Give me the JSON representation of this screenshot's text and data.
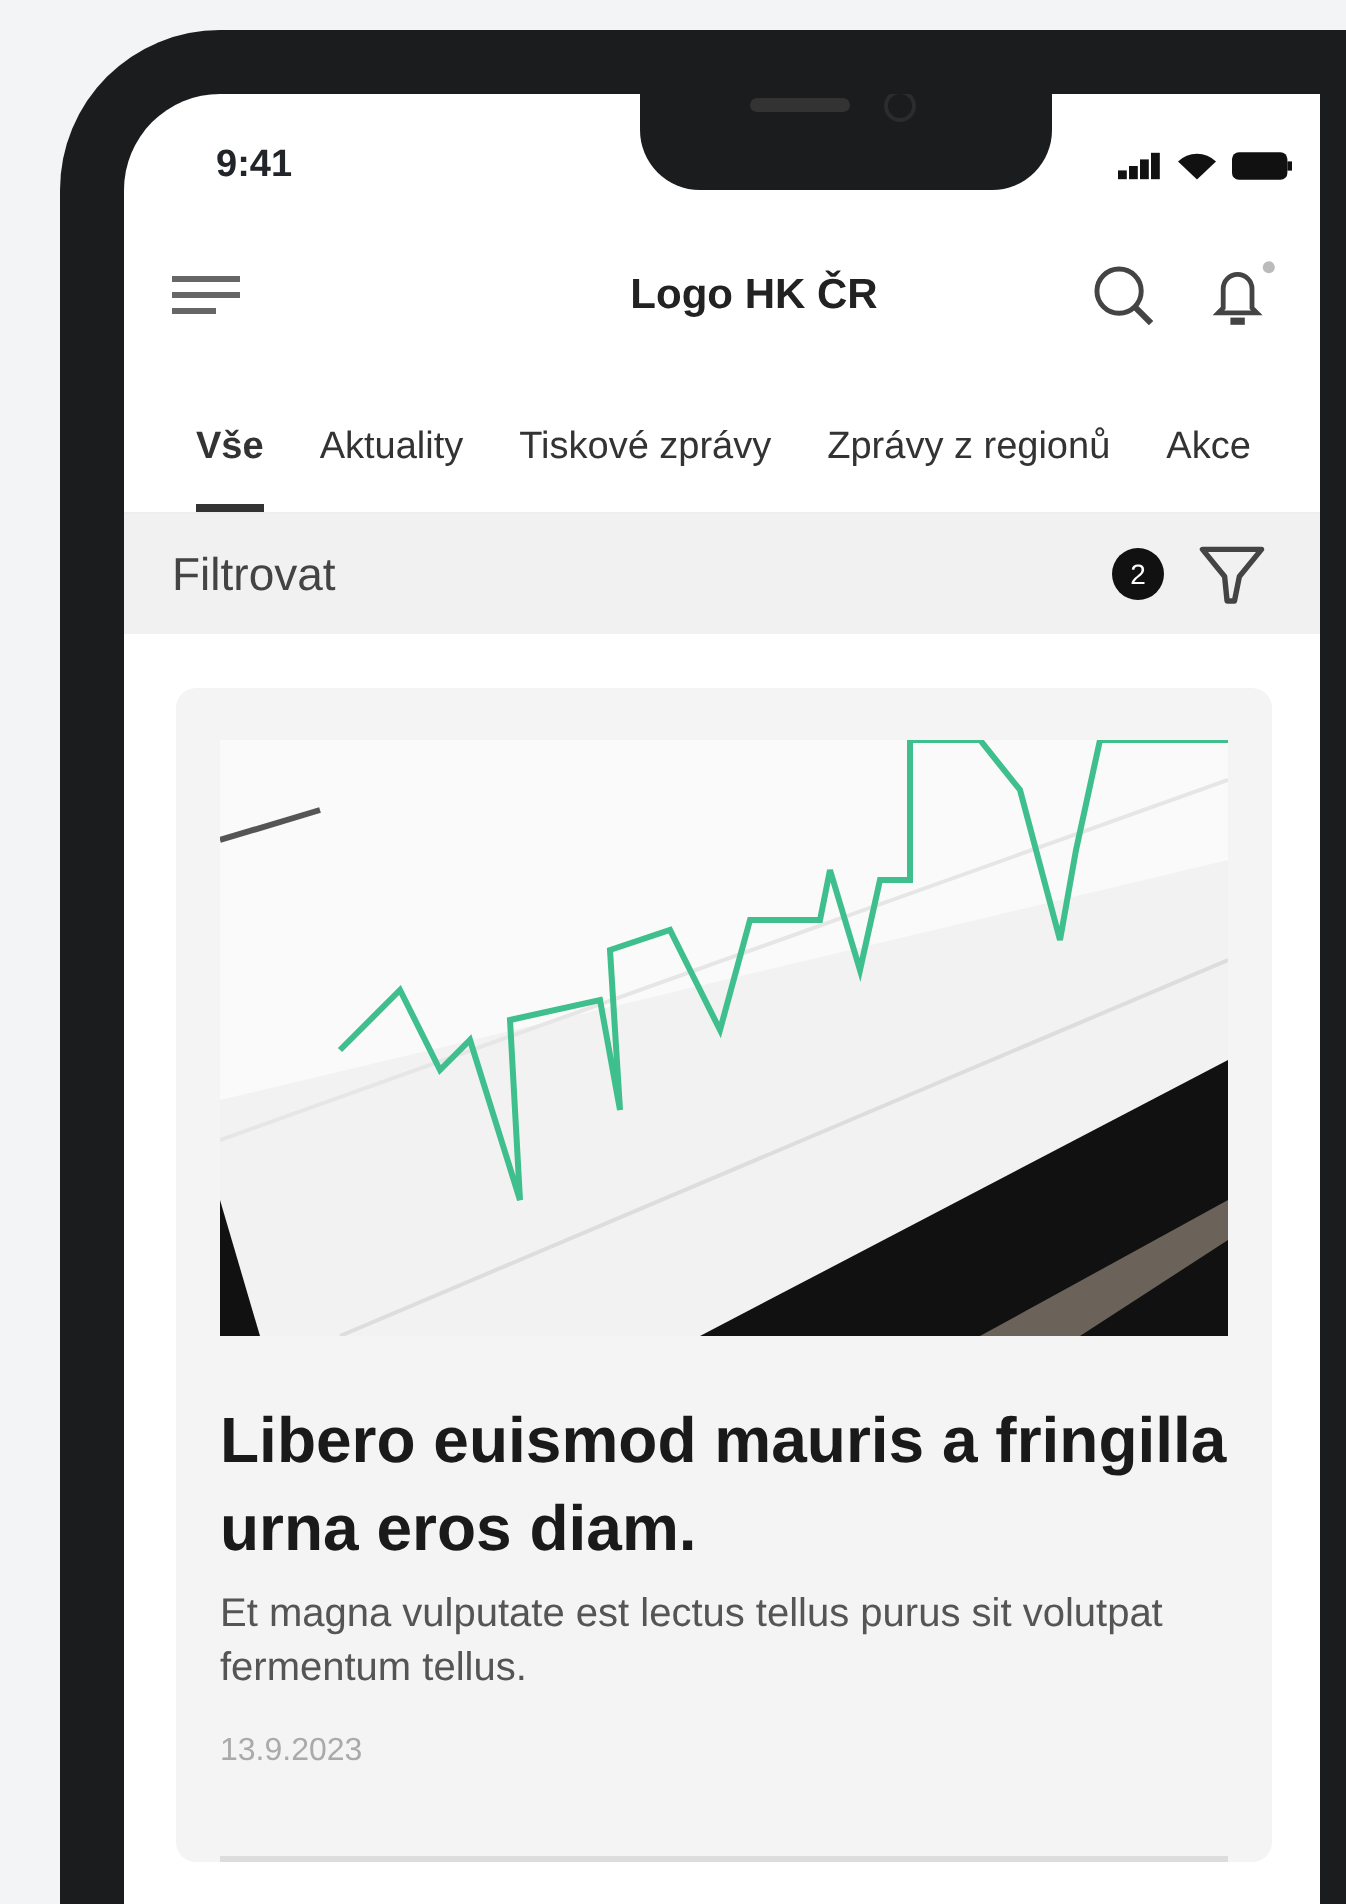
{
  "status_bar": {
    "time": "9:41"
  },
  "header": {
    "title": "Logo HK ČR",
    "notification_dot": true
  },
  "tabs": [
    {
      "label": "Vše",
      "selected": true
    },
    {
      "label": "Aktuality",
      "selected": false
    },
    {
      "label": "Tiskové zprávy",
      "selected": false
    },
    {
      "label": "Zprávy z regionů",
      "selected": false
    },
    {
      "label": "Akce",
      "selected": false
    }
  ],
  "filter": {
    "label": "Filtrovat",
    "count": "2"
  },
  "articles": [
    {
      "title": "Libero euismod mauris a fringilla urna eros diam.",
      "excerpt": "Et magna vulputate est lectus tellus purus sit volutpat fermentum tellus.",
      "date": "13.9.2023"
    }
  ]
}
